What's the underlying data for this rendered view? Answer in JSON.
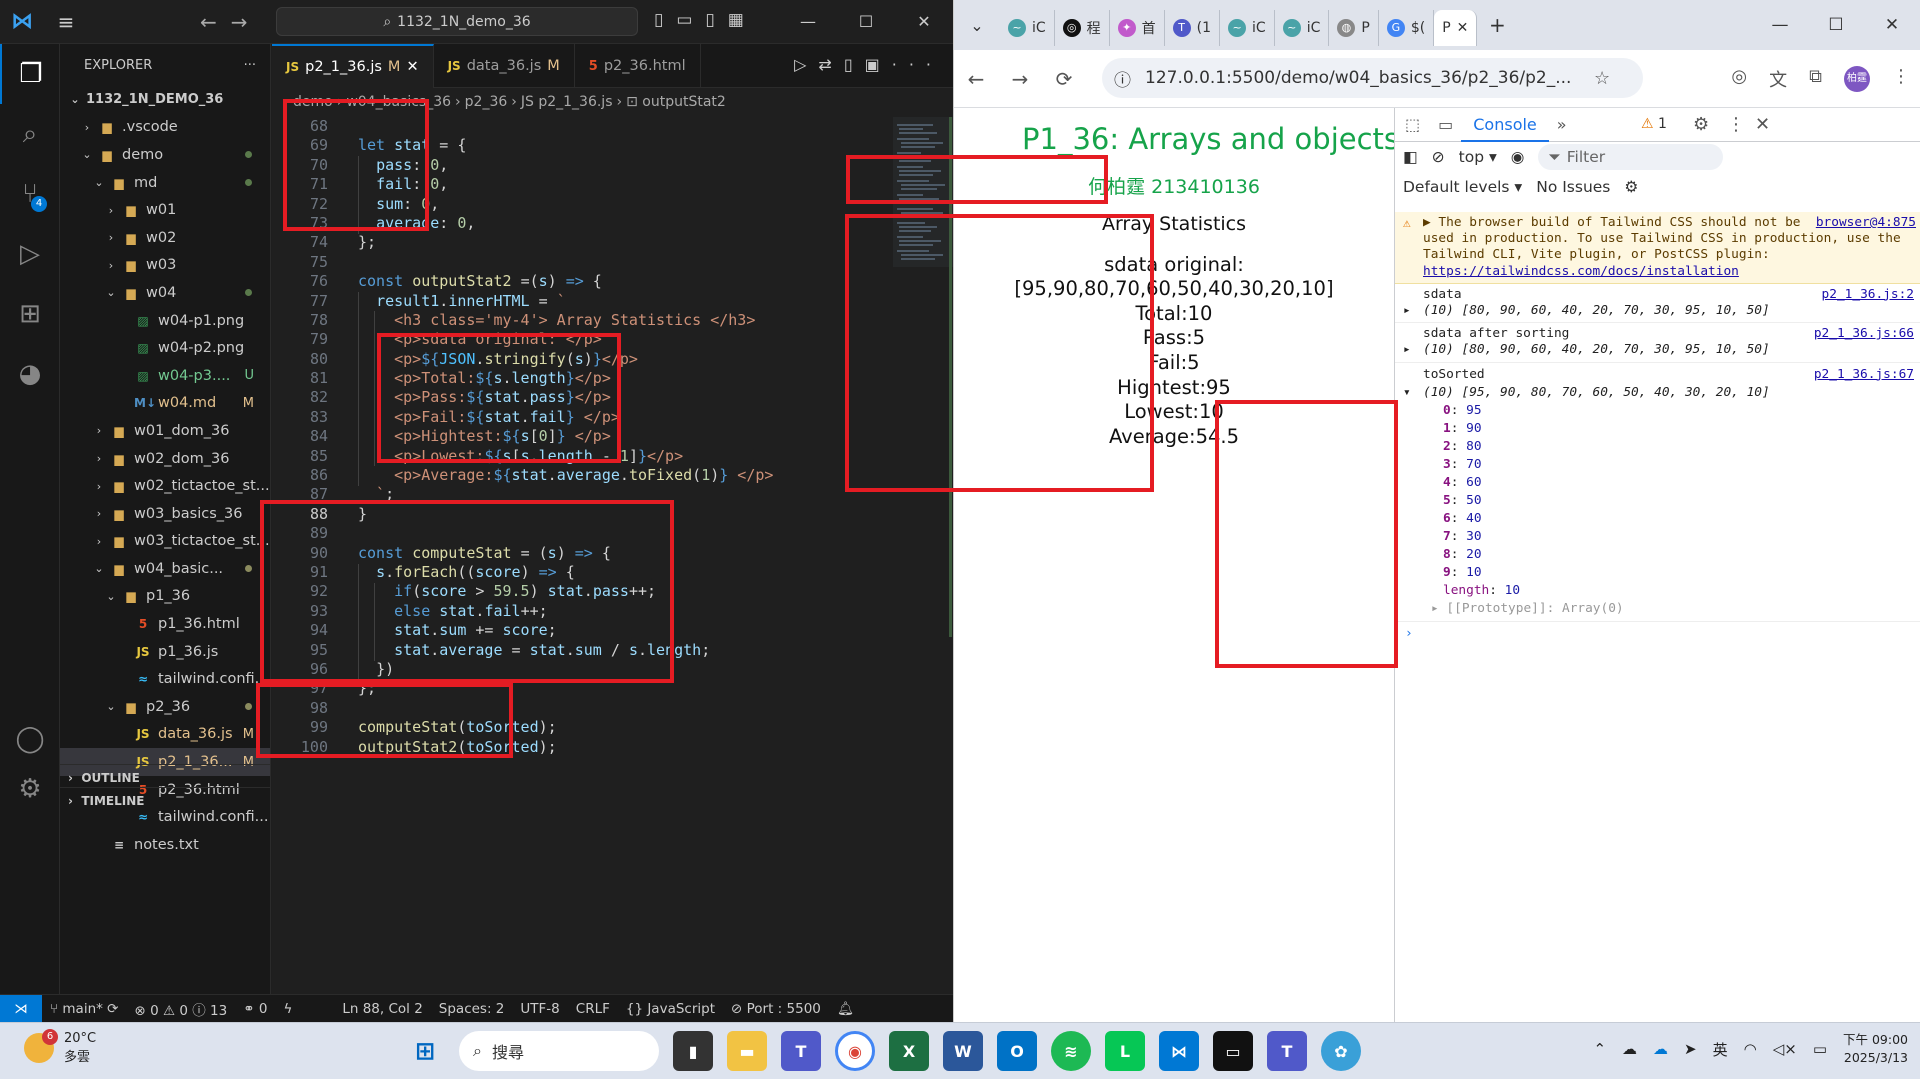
{
  "vscode": {
    "search": "1132_1N_demo_36",
    "explorer_title": "EXPLORER",
    "tree": [
      {
        "label": "1132_1N_DEMO_36",
        "indent": 0,
        "kind": "root",
        "twist": "⌄"
      },
      {
        "label": ".vscode",
        "indent": 1,
        "kind": "folder",
        "twist": "›"
      },
      {
        "label": "demo",
        "indent": 1,
        "kind": "folder",
        "twist": "⌄",
        "mark": "dotg"
      },
      {
        "label": "md",
        "indent": 2,
        "kind": "folder",
        "twist": "⌄",
        "mark": "dotg"
      },
      {
        "label": "w01",
        "indent": 3,
        "kind": "folder",
        "twist": "›"
      },
      {
        "label": "w02",
        "indent": 3,
        "kind": "folder",
        "twist": "›"
      },
      {
        "label": "w03",
        "indent": 3,
        "kind": "folder",
        "twist": "›"
      },
      {
        "label": "w04",
        "indent": 3,
        "kind": "folder",
        "twist": "⌄",
        "mark": "dotg"
      },
      {
        "label": "w04-p1.png",
        "indent": 4,
        "kind": "png"
      },
      {
        "label": "w04-p2.png",
        "indent": 4,
        "kind": "png"
      },
      {
        "label": "w04-p3....",
        "indent": 4,
        "kind": "png",
        "mark": "U"
      },
      {
        "label": "w04.md",
        "indent": 4,
        "kind": "md",
        "mark": "M"
      },
      {
        "label": "w01_dom_36",
        "indent": 2,
        "kind": "folder",
        "twist": "›"
      },
      {
        "label": "w02_dom_36",
        "indent": 2,
        "kind": "folder",
        "twist": "›"
      },
      {
        "label": "w02_tictactoe_st...",
        "indent": 2,
        "kind": "folder",
        "twist": "›"
      },
      {
        "label": "w03_basics_36",
        "indent": 2,
        "kind": "folder",
        "twist": "›"
      },
      {
        "label": "w03_tictactoe_st...",
        "indent": 2,
        "kind": "folder",
        "twist": "›"
      },
      {
        "label": "w04_basic...",
        "indent": 2,
        "kind": "folder",
        "twist": "⌄",
        "mark": "dot"
      },
      {
        "label": "p1_36",
        "indent": 3,
        "kind": "folder",
        "twist": "⌄"
      },
      {
        "label": "p1_36.html",
        "indent": 4,
        "kind": "html"
      },
      {
        "label": "p1_36.js",
        "indent": 4,
        "kind": "js"
      },
      {
        "label": "tailwind.confi...",
        "indent": 4,
        "kind": "tw"
      },
      {
        "label": "p2_36",
        "indent": 3,
        "kind": "folder",
        "twist": "⌄",
        "mark": "dot"
      },
      {
        "label": "data_36.js",
        "indent": 4,
        "kind": "js",
        "mark": "M"
      },
      {
        "label": "p2_1_36...",
        "indent": 4,
        "kind": "js",
        "mark": "M",
        "selected": true
      },
      {
        "label": "p2_36.html",
        "indent": 4,
        "kind": "html"
      },
      {
        "label": "tailwind.confi...",
        "indent": 4,
        "kind": "tw"
      },
      {
        "label": "notes.txt",
        "indent": 2,
        "kind": "txt"
      }
    ],
    "outline": "OUTLINE",
    "timeline": "TIMELINE",
    "tabs": [
      {
        "icon": "JS",
        "label": "p2_1_36.js",
        "mod": "M",
        "active": true,
        "close": "✕"
      },
      {
        "icon": "JS",
        "label": "data_36.js",
        "mod": "M"
      },
      {
        "icon": "5",
        "label": "p2_36.html",
        "mod": ""
      }
    ],
    "breadcrumbs": [
      "demo",
      "w04_basics_36",
      "p2_36",
      "JS p2_1_36.js",
      "⊡ outputStat2"
    ],
    "status": {
      "branch": "main*",
      "problems": "⊗ 0 ⚠ 0 ⓘ 13",
      "ports": "⚭ 0",
      "position": "Ln 88, Col 2",
      "spaces": "Spaces: 2",
      "encoding": "UTF-8",
      "eol": "CRLF",
      "language": "{} JavaScript",
      "port": "⊘ Port : 5500"
    }
  },
  "chrome": {
    "tabs": [
      "iC",
      "程",
      "首",
      "(1",
      "iC",
      "iC",
      "P",
      "$(",
      "P"
    ],
    "url": "127.0.0.1:5500/demo/w04_basics_36/p2_36/p2_...",
    "profile": "柏霆",
    "page": {
      "title": "P1_36: Arrays and objects",
      "name": "何柏霆 213410136",
      "heading": "Array Statistics",
      "original_label": "sdata original:",
      "original_value": "[95,90,80,70,60,50,40,30,20,10]",
      "total": "Total:10",
      "pass": "Pass:5",
      "fail": "Fail:5",
      "highest": "Hightest:95",
      "lowest": "Lowest:10",
      "average": "Average:54.5"
    },
    "devtools": {
      "tab": "Console",
      "warnings": "1",
      "context": "top",
      "filter": "Filter",
      "levels": "Default levels",
      "issues": "No Issues",
      "warn_text": "▶ The browser build of Tailwind CSS should not be used in production. To use Tailwind CSS in production, use the Tailwind CLI, Vite plugin, or PostCSS plugin:",
      "warn_link": "https://tailwindcss.com/docs/installation",
      "warn_src": "browser@4:875",
      "log1_label": "sdata",
      "log1_src": "p2_1_36.js:2",
      "log1_val": "(10) [80, 90, 60, 40, 20, 70, 30, 95, 10, 50]",
      "log2_label": "sdata after sorting",
      "log2_src": "p2_1_36.js:66",
      "log2_val": "(10) [80, 90, 60, 40, 20, 70, 30, 95, 10, 50]",
      "log3_label": "toSorted",
      "log3_src": "p2_1_36.js:67",
      "log3_val": "(10) [95, 90, 80, 70, 60, 50, 40, 30, 20, 10]",
      "items": [
        "95",
        "90",
        "80",
        "70",
        "60",
        "50",
        "40",
        "30",
        "20",
        "10"
      ],
      "length": "10",
      "proto": "[[Prototype]]: Array(0)"
    }
  },
  "taskbar": {
    "temp": "20°C",
    "cond": "多雲",
    "badge": "6",
    "search": "搜尋",
    "ime": "英",
    "time": "下午 09:00",
    "date": "2025/3/13"
  }
}
